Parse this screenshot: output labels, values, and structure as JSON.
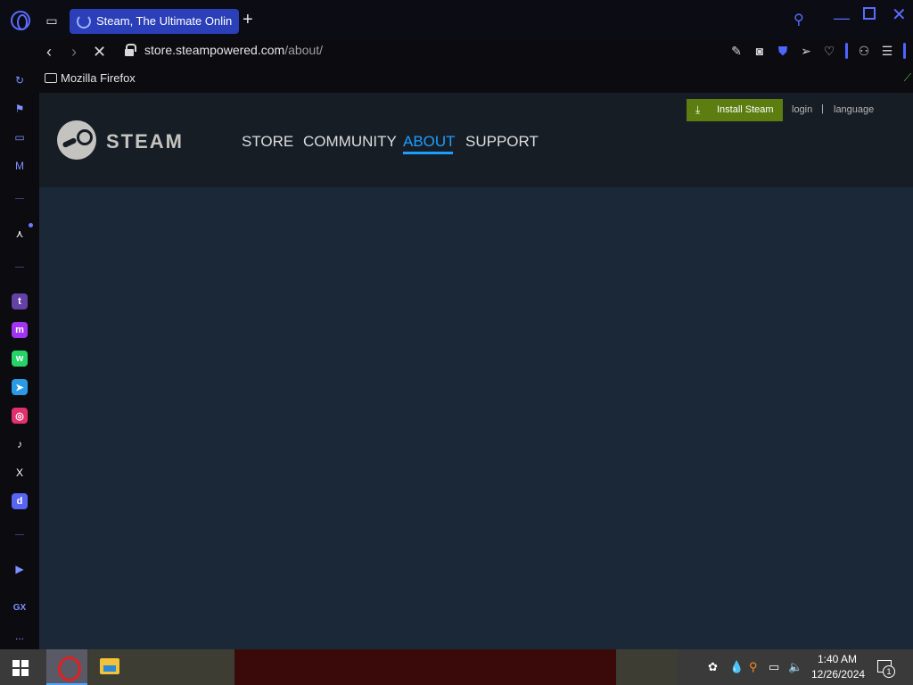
{
  "browser": {
    "tab_title": "Steam, The Ultimate Onlin",
    "url_domain": "store.steampowered.com",
    "url_path": "/about/",
    "bookmark_folder": "Mozilla Firefox"
  },
  "sidebar": {
    "items": [
      "speed-dial-icon",
      "easy-setup-icon",
      "video-pop-out-icon",
      "music-player-icon",
      "aria-icon",
      "twitch-icon",
      "messenger-icon",
      "whatsapp-icon",
      "telegram-icon",
      "instagram-icon",
      "tiktok-icon",
      "x-icon",
      "discord-icon",
      "player-icon",
      "gx-icon",
      "more-icon"
    ],
    "gx_label": "GX",
    "more_label": "..."
  },
  "steam": {
    "wordmark": "STEAM",
    "nav": [
      "STORE",
      "COMMUNITY",
      "ABOUT",
      "SUPPORT"
    ],
    "active_nav": "ABOUT",
    "install_label": "Install Steam",
    "login_label": "login",
    "language_label": "language",
    "separator": "|"
  },
  "taskbar": {
    "time": "1:40 AM",
    "date": "12/26/2024",
    "notification_count": "1"
  },
  "colors": {
    "steam_bg": "#1b2838",
    "steam_header": "#171d25",
    "steam_accent": "#1a9fff",
    "install_green": "#5c7e10",
    "opera_accent": "#5a6cff",
    "tab_active": "#2b3fb8"
  }
}
